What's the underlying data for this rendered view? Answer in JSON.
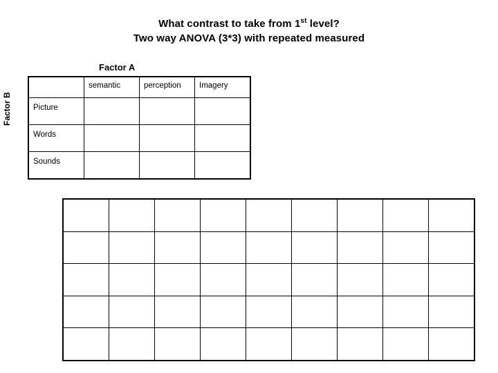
{
  "slide": {
    "title_line1_pre": "What contrast to take from 1",
    "title_line1_sup": "st",
    "title_line1_post": " level?",
    "title_line2": "Two way ANOVA (3*3) with repeated measured",
    "factor_a_label": "Factor A",
    "factor_b_label": "Factor B"
  },
  "top_table": {
    "corner_cell": "",
    "column_headers": [
      "semantic",
      "perception",
      "Imagery"
    ],
    "rows": [
      {
        "label": "Picture",
        "cells": [
          "",
          "",
          ""
        ]
      },
      {
        "label": "Words",
        "cells": [
          "",
          "",
          ""
        ]
      },
      {
        "label": "Sounds",
        "cells": [
          "",
          "",
          ""
        ]
      }
    ]
  },
  "bottom_table": {
    "rows": 5,
    "cols": 9,
    "cells": [
      [
        "",
        "",
        "",
        "",
        "",
        "",
        "",
        "",
        ""
      ],
      [
        "",
        "",
        "",
        "",
        "",
        "",
        "",
        "",
        ""
      ],
      [
        "",
        "",
        "",
        "",
        "",
        "",
        "",
        "",
        ""
      ],
      [
        "",
        "",
        "",
        "",
        "",
        "",
        "",
        "",
        ""
      ],
      [
        "",
        "",
        "",
        "",
        "",
        "",
        "",
        "",
        ""
      ]
    ]
  },
  "colors": {
    "text": "#000000",
    "border": "#000000",
    "background": "#ffffff"
  }
}
